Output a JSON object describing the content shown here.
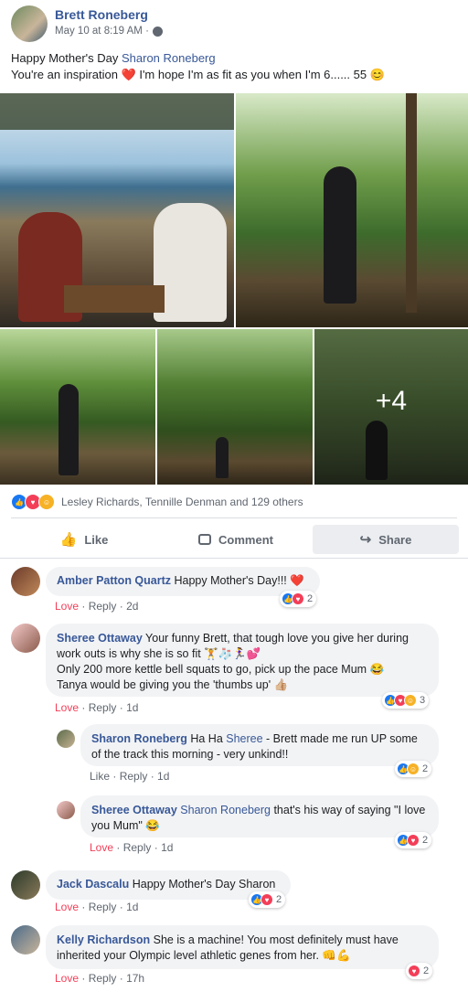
{
  "post": {
    "author": "Brett Roneberg",
    "timestamp": "May 10 at 8:19 AM ·",
    "line1_prefix": "Happy Mother's Day ",
    "line1_mention": "Sharon Roneberg",
    "line2": "You're an inspiration ❤️ I'm hope I'm as fit as you when I'm 6...... 55 😊",
    "more_photos": "+4",
    "reactions_text": "Lesley Richards, Tennille Denman and 129 others",
    "actions": {
      "like": "Like",
      "comment": "Comment",
      "share": "Share"
    }
  },
  "comments": [
    {
      "author": "Amber Patton Quartz",
      "text": "Happy Mother's Day!!! ❤️",
      "love": "Love",
      "reply": "Reply",
      "time": "2d",
      "count": "2"
    },
    {
      "author": "Sheree Ottaway",
      "text": "Your funny Brett, that tough love you give her during work outs is why she is so fit 🏋️🧦🏃‍♀️💕",
      "text2": "Only 200 more kettle bell squats to go, pick up the pace Mum 😂",
      "text3": "Tanya would be giving you the 'thumbs up' 👍🏼",
      "love": "Love",
      "reply": "Reply",
      "time": "1d",
      "count": "3"
    },
    {
      "author": "Sharon Roneberg",
      "prefix": "Ha Ha ",
      "mention": "Sheree",
      "text": " - Brett made me run UP some of the track this morning - very unkind!!",
      "like": "Like",
      "reply": "Reply",
      "time": "1d",
      "count": "2"
    },
    {
      "author": "Sheree Ottaway",
      "mention": "Sharon Roneberg",
      "text": " that's his way of saying \"I love you Mum\" 😂",
      "love": "Love",
      "reply": "Reply",
      "time": "1d",
      "count": "2"
    },
    {
      "author": "Jack Dascalu",
      "text": "Happy Mother's Day Sharon",
      "love": "Love",
      "reply": "Reply",
      "time": "1d",
      "count": "2"
    },
    {
      "author": "Kelly Richardson",
      "text": "She is a machine! You most definitely must have inherited your Olympic level athletic genes from her. 👊💪",
      "love": "Love",
      "reply": "Reply",
      "time": "17h",
      "count": "2"
    }
  ]
}
